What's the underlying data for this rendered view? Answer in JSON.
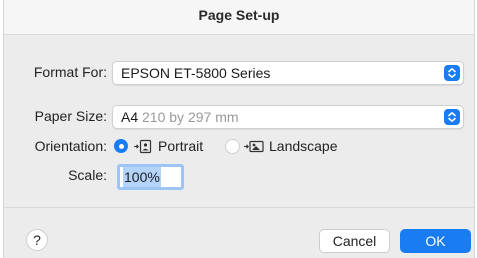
{
  "window": {
    "title": "Page Set-up"
  },
  "format_for": {
    "label": "Format For:",
    "value": "EPSON ET-5800 Series"
  },
  "paper_size": {
    "label": "Paper Size:",
    "value": "A4",
    "detail": "210 by 297 mm"
  },
  "orientation": {
    "label": "Orientation:",
    "options": [
      {
        "label": "Portrait",
        "icon": "portrait-orientation-icon",
        "selected": true
      },
      {
        "label": "Landscape",
        "icon": "landscape-orientation-icon",
        "selected": false
      }
    ]
  },
  "scale": {
    "label": "Scale:",
    "value": "100%"
  },
  "footer": {
    "help_label": "?",
    "cancel_label": "Cancel",
    "ok_label": "OK"
  },
  "colors": {
    "accent": "#1a7cf3"
  }
}
